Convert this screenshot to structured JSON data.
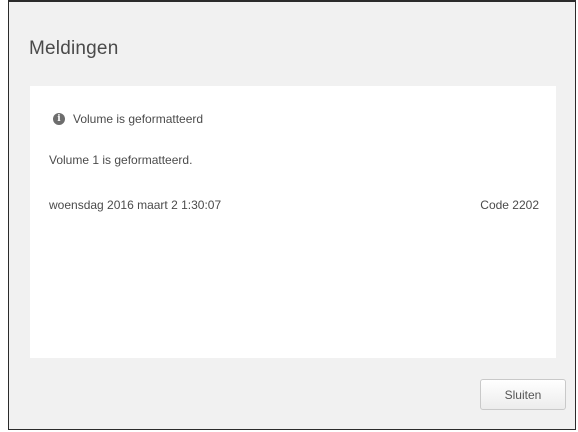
{
  "dialog": {
    "title": "Meldingen"
  },
  "notification": {
    "icon": "info-icon",
    "heading": "Volume is geformatteerd",
    "message": "Volume 1 is geformatteerd.",
    "date": "woensdag 2016 maart 2 1:30:07",
    "code": "Code 2202"
  },
  "buttons": {
    "close_label": "Sluiten"
  },
  "colors": {
    "dialog_background": "#f1f1f1",
    "panel_background": "#ffffff",
    "text": "#4b4b4b",
    "border": "#2b2b2b"
  }
}
